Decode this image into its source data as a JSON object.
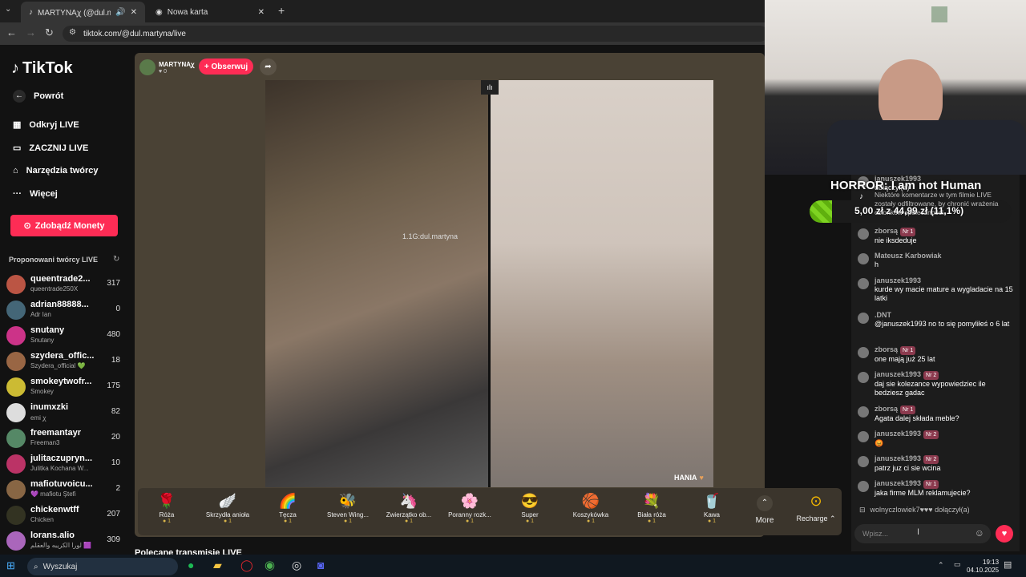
{
  "browser": {
    "tabs": [
      {
        "label": "MARTYNAꭕ (@dul.martyna"
      },
      {
        "label": "Nowa karta"
      }
    ],
    "url": "tiktok.com/@dul.martyna/live"
  },
  "sidebar": {
    "logo": "TikTok",
    "back": "Powrót",
    "nav": [
      "Odkryj LIVE",
      "ZACZNIJ LIVE",
      "Narzędzia twórcy",
      "Więcej"
    ],
    "coins_button": "Zdobądź Monety",
    "suggested_title": "Proponowani twórcy LIVE",
    "creators": [
      {
        "name": "queentrade2...",
        "sub": "queentrade250X",
        "viewers": "317"
      },
      {
        "name": "adrian88888...",
        "sub": "Adr Ian",
        "viewers": "0"
      },
      {
        "name": "snutany",
        "sub": "Snutany",
        "viewers": "480"
      },
      {
        "name": "szydera_offic...",
        "sub": "Szydera_official 💚",
        "viewers": "18"
      },
      {
        "name": "smokeytwofr...",
        "sub": "Smokey",
        "viewers": "175"
      },
      {
        "name": "inumxzki",
        "sub": "emi ꭕ",
        "viewers": "82"
      },
      {
        "name": "freemantayr",
        "sub": "Freeman3",
        "viewers": "20"
      },
      {
        "name": "julitaczupryn...",
        "sub": "Julitka Kochana W...",
        "viewers": "10"
      },
      {
        "name": "mafiotuvoicu...",
        "sub": "💜 mafiotu Ştefi",
        "viewers": "2"
      },
      {
        "name": "chickenwtff",
        "sub": "Chicken",
        "viewers": "207"
      },
      {
        "name": "lorans.alio",
        "sub": "لورا الكريبه والعقلم 🟪",
        "viewers": "309"
      }
    ]
  },
  "live": {
    "host_name": "MARTYNAꭕ",
    "host_likes": "0",
    "follow_button": "+ Obserwuj",
    "overlay_text": "1.1G:dul.martyna",
    "guest_label": "HANIA",
    "recommended": "Polecane transmisje LIVE"
  },
  "gifts": [
    {
      "icon": "🌹",
      "name": "Róża",
      "cost": "1"
    },
    {
      "icon": "🪽",
      "name": "Skrzydła anioła",
      "cost": "1"
    },
    {
      "icon": "🌈",
      "name": "Tęcza",
      "cost": "1"
    },
    {
      "icon": "🐝",
      "name": "Steven Wing...",
      "cost": "1"
    },
    {
      "icon": "🦄",
      "name": "Zwierzątko ob...",
      "cost": "1"
    },
    {
      "icon": "🌸",
      "name": "Poranny rozk...",
      "cost": "1"
    },
    {
      "icon": "😎",
      "name": "Super",
      "cost": "1"
    },
    {
      "icon": "🏀",
      "name": "Koszykówka",
      "cost": "1"
    },
    {
      "icon": "💐",
      "name": "Biała róża",
      "cost": "1"
    },
    {
      "icon": "🥤",
      "name": "Kawa",
      "cost": "1"
    }
  ],
  "gift_more": "More",
  "recharge": "Recharge",
  "stream_overlay": {
    "title": "HORROR: I am not Human",
    "goal": "5,00 zł z 44,99 zł (11,1%)",
    "goal_fraction": 0.111,
    "disclaimer": "Niektóre komentarze w tym filmie LIVE zostały odfiltrowane, by chronić wrażenia członków społeczności."
  },
  "chat": {
    "messages": [
      {
        "user": "januszek1993",
        "badge": "",
        "text": "dołączył(a)"
      },
      {
        "user": "zborsą",
        "badge": "Nr 1",
        "text": "nie iksdeduje"
      },
      {
        "user": "Mateusz Karbowiak",
        "badge": "",
        "text": "h"
      },
      {
        "user": "januszek1993",
        "badge": "",
        "text": "kurde wy macie mature a wygladacie na 15 latki"
      },
      {
        "user": ".DNT",
        "badge": "",
        "text": "@januszek1993 no to się pomyliłeś o 6 lat"
      },
      {
        "user": "zborsą",
        "badge": "Nr 1",
        "text": "one mają już 25 lat"
      },
      {
        "user": "januszek1993",
        "badge": "Nr 2",
        "text": "daj sie kolezance wypowiedziec ile bedziesz gadac"
      },
      {
        "user": "zborsą",
        "badge": "Nr 1",
        "text": "Agata dalej składa meble?"
      },
      {
        "user": "januszek1993",
        "badge": "Nr 2",
        "text": "😡"
      },
      {
        "user": "januszek1993",
        "badge": "Nr 2",
        "text": "patrz juz ci sie wcina"
      },
      {
        "user": "januszek1993",
        "badge": "Nr 1",
        "text": "jaka firme MLM reklamujecie?"
      }
    ],
    "join_line": "wolnyczlowiek7♥♥♥ dołączył(a)",
    "input_placeholder": "Wpisz..."
  },
  "taskbar": {
    "search": "Wyszukaj",
    "time": "19:13",
    "date": "04.10.2025"
  },
  "colors": {
    "accent": "#fe2c55",
    "goal": "#7ed321"
  }
}
